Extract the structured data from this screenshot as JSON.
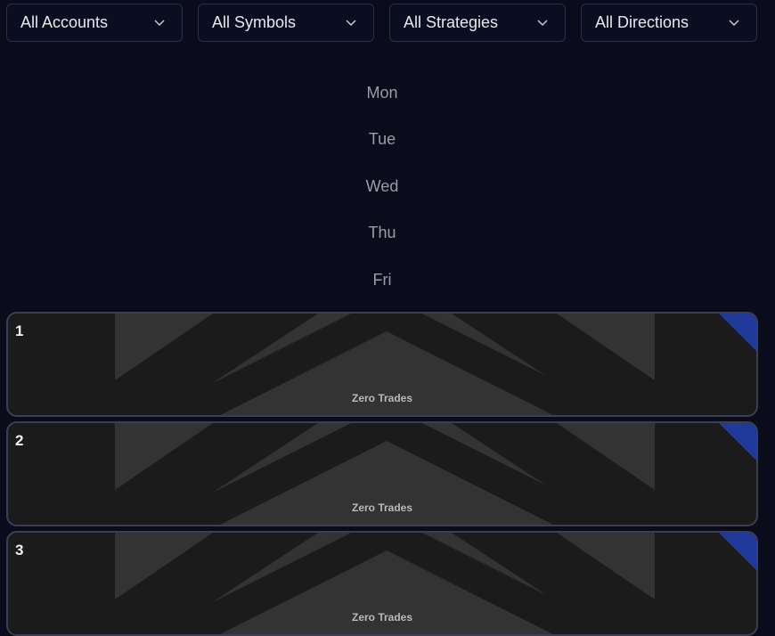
{
  "filters": {
    "accounts": "All Accounts",
    "symbols": "All Symbols",
    "strategies": "All Strategies",
    "directions": "All Directions"
  },
  "days": [
    "Mon",
    "Tue",
    "Wed",
    "Thu",
    "Fri"
  ],
  "weeks": [
    {
      "number": "1",
      "status": "Zero Trades"
    },
    {
      "number": "2",
      "status": "Zero Trades"
    },
    {
      "number": "3",
      "status": "Zero Trades"
    }
  ],
  "colors": {
    "background": "#0a0c1c",
    "card": "#1b1b1b",
    "card_stripe": "#333333",
    "accent_corner": "#1f3a9a"
  }
}
